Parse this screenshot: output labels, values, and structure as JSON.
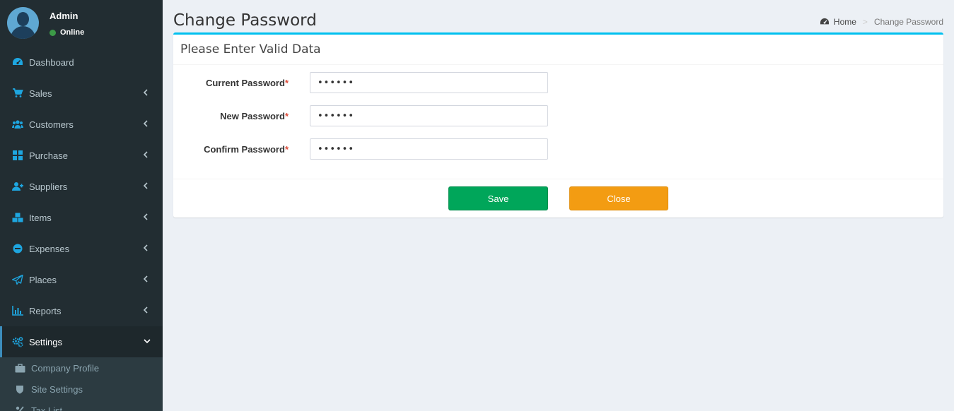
{
  "user": {
    "name": "Admin",
    "status": "Online"
  },
  "sidebar": {
    "items": [
      {
        "label": "Dashboard",
        "icon": "dashboard-icon"
      },
      {
        "label": "Sales",
        "icon": "cart-icon"
      },
      {
        "label": "Customers",
        "icon": "users-icon"
      },
      {
        "label": "Purchase",
        "icon": "grid-icon"
      },
      {
        "label": "Suppliers",
        "icon": "user-plus-icon"
      },
      {
        "label": "Items",
        "icon": "cubes-icon"
      },
      {
        "label": "Expenses",
        "icon": "minus-circle-icon"
      },
      {
        "label": "Places",
        "icon": "paper-plane-icon"
      },
      {
        "label": "Reports",
        "icon": "bar-chart-icon"
      },
      {
        "label": "Settings",
        "icon": "gears-icon"
      }
    ],
    "settings_submenu": [
      {
        "label": "Company Profile",
        "icon": "briefcase-icon"
      },
      {
        "label": "Site Settings",
        "icon": "shield-icon"
      },
      {
        "label": "Tax List",
        "icon": "percent-icon"
      }
    ]
  },
  "page": {
    "title": "Change Password",
    "breadcrumb": {
      "home": "Home",
      "current": "Change Password"
    }
  },
  "form": {
    "title": "Please Enter Valid Data",
    "required_mark": "*",
    "fields": [
      {
        "label": "Current Password",
        "value": "••••••"
      },
      {
        "label": "New Password",
        "value": "••••••"
      },
      {
        "label": "Confirm Password",
        "value": "••••••"
      }
    ],
    "save_label": "Save",
    "close_label": "Close"
  },
  "colors": {
    "sidebar_bg": "#222d32",
    "accent": "#00c0ef",
    "save": "#00a65a",
    "close": "#f39c12",
    "icon_blue": "#1ea6e0"
  }
}
